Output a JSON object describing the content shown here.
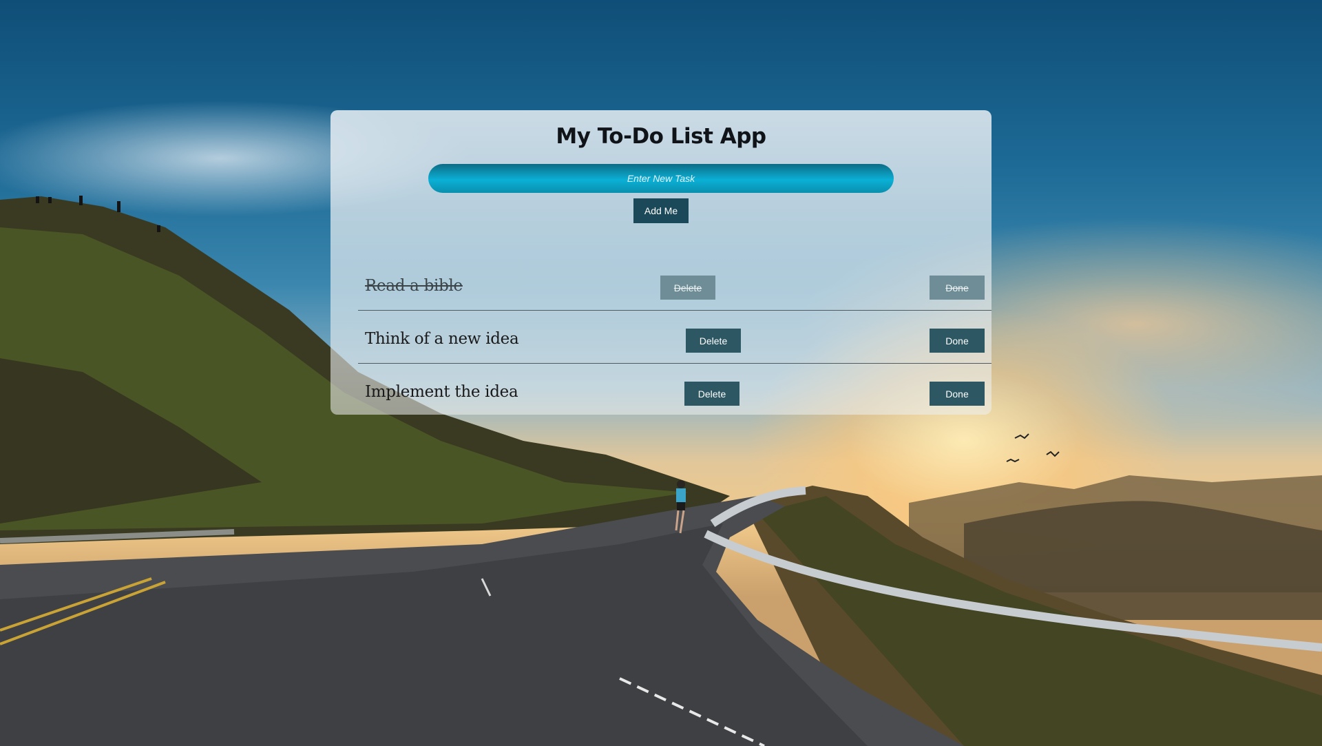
{
  "app": {
    "title": "My To-Do List App",
    "input_placeholder": "Enter New Task",
    "input_value": "",
    "add_label": "Add Me"
  },
  "tasks": [
    {
      "text": "Read a bible",
      "completed": true,
      "delete_label": "Delete",
      "done_label": "Done"
    },
    {
      "text": "Think of a new idea",
      "completed": false,
      "delete_label": "Delete",
      "done_label": "Done"
    },
    {
      "text": "Implement the idea",
      "completed": false,
      "delete_label": "Delete",
      "done_label": "Done"
    }
  ],
  "colors": {
    "button_bg": "#1b4959",
    "row_button_bg": "#2d5863",
    "input_gradient_mid": "#0bb0d6"
  }
}
